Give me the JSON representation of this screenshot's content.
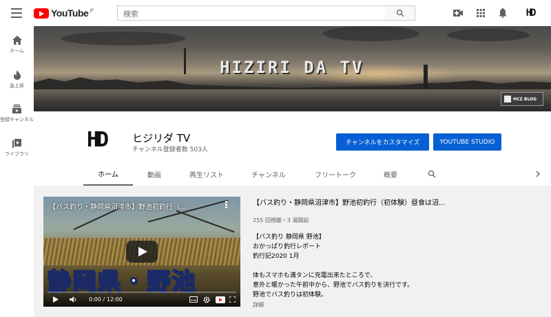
{
  "topbar": {
    "logo_text": "YouTube",
    "logo_region": "JP",
    "search_placeholder": "検索"
  },
  "sidebar": {
    "items": [
      {
        "label": "ホーム",
        "icon": "home-icon"
      },
      {
        "label": "急上昇",
        "icon": "flame-icon"
      },
      {
        "label": "登録チャンネル",
        "icon": "subscriptions-icon"
      },
      {
        "label": "ライブラリ",
        "icon": "library-icon"
      }
    ]
  },
  "banner": {
    "title": "HIZIRI DA TV",
    "badge": "HCZ BLOG"
  },
  "channel": {
    "avatar_text": "HD",
    "name": "ヒジリダ TV",
    "subscribers": "チャンネル登録者数 503人",
    "customize_button": "チャンネルをカスタマイズ",
    "studio_button": "YOUTUBE STUDIO"
  },
  "tabs": [
    "ホーム",
    "動画",
    "再生リスト",
    "チャンネル",
    "フリートーク",
    "概要"
  ],
  "featured": {
    "thumb_title": "【バス釣り・静岡県沼津市】野池初釣行（...",
    "overlay_text": "静岡県・野池",
    "time": "0:00 / 12:00",
    "title": "【バス釣り・静岡県沼津市】野池初釣行（初体験）昼食は沼...",
    "meta": "255 回視聴・3 週間前",
    "description": [
      "【バス釣り 静岡県 野池】",
      "おかっぱり釣行レポート",
      "釣行記2020 1月",
      "",
      "体もスマホも満タンに充電出来たところで、",
      "意外と暖かった午前中から、野池でバス釣りを決行です。",
      "野池でバス釣りは初体験。"
    ],
    "more": "詳細"
  }
}
